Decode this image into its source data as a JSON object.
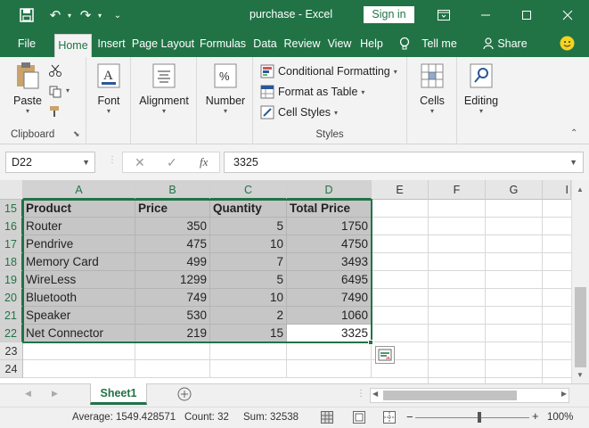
{
  "app": {
    "document_title": "purchase",
    "separator": " - ",
    "app_name": "Excel",
    "signin_label": "Sign in"
  },
  "tabs": [
    "File",
    "Home",
    "Insert",
    "Page Layout",
    "Formulas",
    "Data",
    "Review",
    "View",
    "Help"
  ],
  "tell_me": "Tell me",
  "share": "Share",
  "ribbon": {
    "paste": "Paste",
    "clipboard": "Clipboard",
    "font": "Font",
    "alignment": "Alignment",
    "number": "Number",
    "conditional_formatting": "Conditional Formatting",
    "format_as_table": "Format as Table",
    "cell_styles": "Cell Styles",
    "styles": "Styles",
    "cells": "Cells",
    "editing": "Editing"
  },
  "formula_bar": {
    "name_box": "D22",
    "fx": "fx",
    "value": "3325"
  },
  "columns": [
    "A",
    "B",
    "C",
    "D",
    "E",
    "F",
    "G",
    "I"
  ],
  "rows": [
    "15",
    "16",
    "17",
    "18",
    "19",
    "20",
    "21",
    "22",
    "23",
    "24"
  ],
  "table": {
    "headers": [
      "Product",
      "Price",
      "Quantity",
      "Total Price"
    ],
    "rows": [
      [
        "Router",
        "350",
        "5",
        "1750"
      ],
      [
        "Pendrive",
        "475",
        "10",
        "4750"
      ],
      [
        "Memory Card",
        "499",
        "7",
        "3493"
      ],
      [
        "WireLess",
        "1299",
        "5",
        "6495"
      ],
      [
        "Bluetooth",
        "749",
        "10",
        "7490"
      ],
      [
        "Speaker",
        "530",
        "2",
        "1060"
      ],
      [
        "Net Connector",
        "219",
        "15",
        "3325"
      ]
    ]
  },
  "sheet_tab": "Sheet1",
  "status": {
    "average": "Average: 1549.428571",
    "count": "Count: 32",
    "sum": "Sum: 32538",
    "zoom": "100%"
  },
  "colors": {
    "brand": "#217346",
    "selection_fill": "#c6c6c6"
  }
}
